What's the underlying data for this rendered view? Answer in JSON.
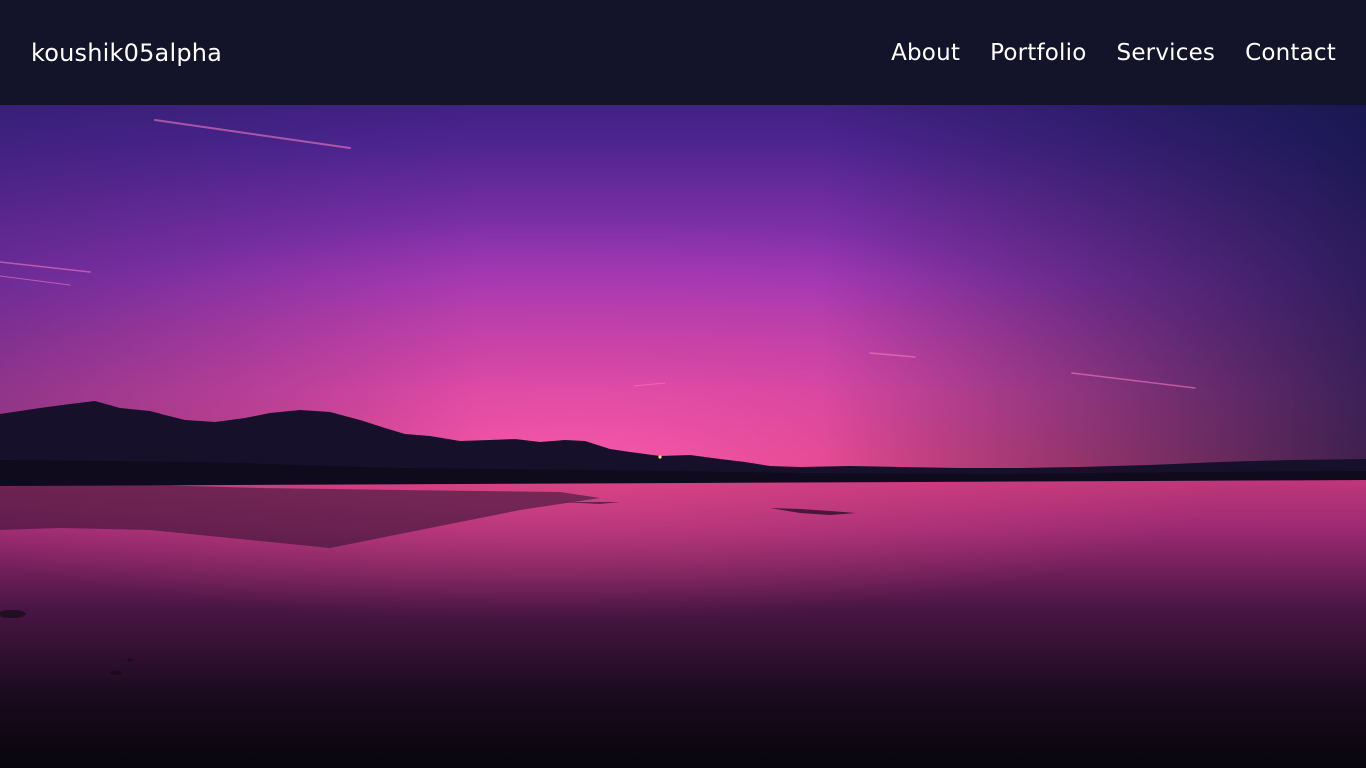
{
  "navbar": {
    "brand": "koushik05alpha",
    "links": [
      "About",
      "Portfolio",
      "Services",
      "Contact"
    ]
  },
  "colors": {
    "navbar_bg": "#13132a",
    "nav_text": "#ffffff",
    "sky_top": "#1a1550",
    "sky_mid": "#8a2fb0",
    "horizon_glow": "#f25bb0",
    "water_dark": "#0a0810"
  }
}
